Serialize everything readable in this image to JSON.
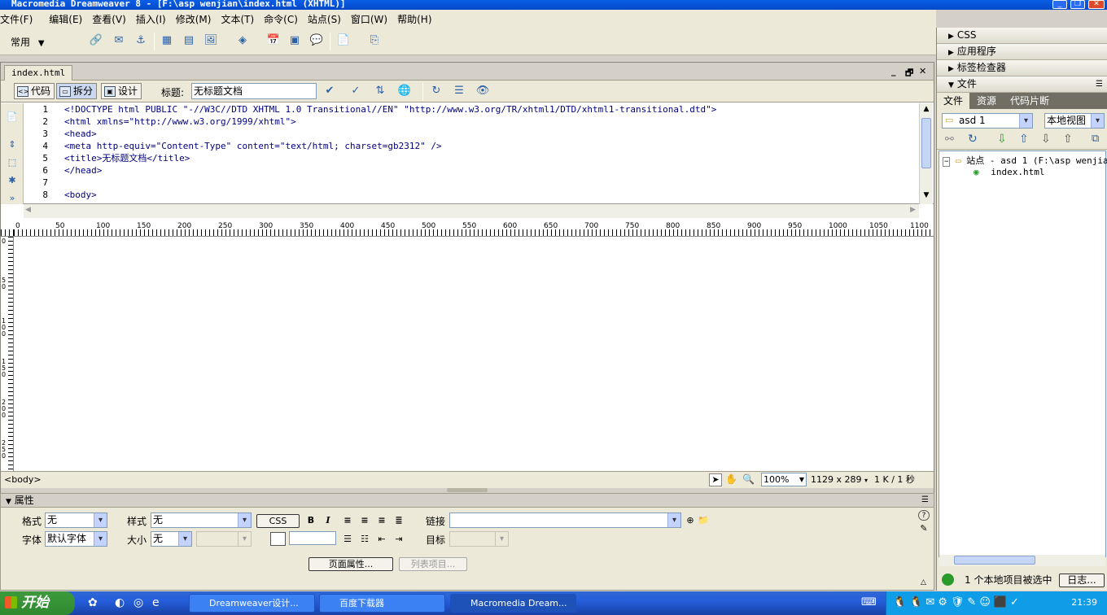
{
  "window": {
    "title": "Macromedia Dreamweaver 8 - [F:\\asp wenjian\\index.html (XHTML)]"
  },
  "menu": [
    "文件(F)",
    "编辑(E)",
    "查看(V)",
    "插入(I)",
    "修改(M)",
    "文本(T)",
    "命令(C)",
    "站点(S)",
    "窗口(W)",
    "帮助(H)"
  ],
  "insertbar": {
    "category": "常用"
  },
  "document": {
    "tab": "index.html",
    "views": {
      "code": "代码",
      "split": "拆分",
      "design": "设计"
    },
    "title_label": "标题:",
    "title_value": "无标题文档"
  },
  "code": {
    "line_numbers": [
      "1",
      "2",
      "3",
      "4",
      "5",
      "6",
      "7",
      "8"
    ],
    "lines": [
      "<!DOCTYPE html PUBLIC \"-//W3C//DTD XHTML 1.0 Transitional//EN\" \"http://www.w3.org/TR/xhtml1/DTD/xhtml1-transitional.dtd\">",
      "<html xmlns=\"http://www.w3.org/1999/xhtml\">",
      "<head>",
      "<meta http-equiv=\"Content-Type\" content=\"text/html; charset=gb2312\" />",
      "<title>无标题文档</title>",
      "</head>",
      "",
      "<body>"
    ]
  },
  "ruler": {
    "h_labels": [
      "0",
      "50",
      "100",
      "150",
      "200",
      "250",
      "300",
      "350",
      "400",
      "450",
      "500",
      "550",
      "600",
      "650",
      "700",
      "750",
      "800",
      "850",
      "900",
      "950",
      "1000",
      "1050",
      "1100"
    ],
    "v_labels": [
      "0",
      "50",
      "100",
      "150",
      "200",
      "250"
    ]
  },
  "status": {
    "tag": "<body>",
    "zoom": "100%",
    "size": "1129 x 289",
    "weight": "1 K / 1 秒"
  },
  "properties": {
    "header": "属性",
    "format_label": "格式",
    "format_value": "无",
    "style_label": "样式",
    "style_value": "无",
    "css_button": "CSS",
    "bold": "B",
    "italic": "I",
    "link_label": "链接",
    "font_label": "字体",
    "font_value": "默认字体",
    "size_label": "大小",
    "size_value": "无",
    "target_label": "目标",
    "page_props_button": "页面属性...",
    "list_item_button": "列表项目..."
  },
  "panels": {
    "css": "CSS",
    "application": "应用程序",
    "tag_inspector": "标签检查器",
    "files": "文件",
    "file_tabs": [
      "文件",
      "资源",
      "代码片断"
    ],
    "site_select": "asd 1",
    "view_select": "本地视图",
    "tree_root": "站点 - asd 1 (F:\\asp wenjian)",
    "tree_file": "index.html",
    "status_text": "1 个本地项目被选中",
    "log_button": "日志..."
  },
  "taskbar": {
    "start": "开始",
    "tasks": [
      "Dreamweaver设计...",
      "百度下载器",
      "Macromedia Dream..."
    ],
    "clock": "21:39"
  }
}
